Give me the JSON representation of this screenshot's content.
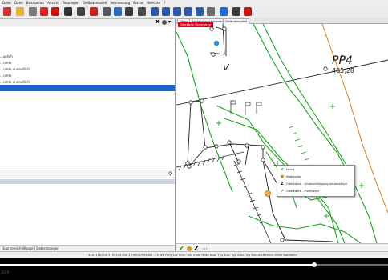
{
  "menubar": [
    "Datei",
    "Datei",
    "Bearbeiten",
    "Ansicht",
    "Bearingen",
    "Geländemodell",
    "Vermessung",
    "Extras",
    "Berichte",
    "?"
  ],
  "left_panel": {
    "items": [
      "...uelich",
      "...rante",
      "...rante undeutlich",
      "...rante",
      "...rante undeutlich",
      ""
    ],
    "selected_index": 5,
    "bottom_label": "Duurbereich-Waage | Datenmanger"
  },
  "map": {
    "tabs": [
      "Demo",
      "Bestand und Kataster",
      "Geländemodell"
    ],
    "red_tip": "Oberkante / Unterkante",
    "labels": {
      "point_name": "PP4",
      "point_value": "405,28",
      "marker": "V"
    },
    "context_menu": [
      {
        "label": "Fertig",
        "icon": "check-icon"
      },
      {
        "label": "Abbrechen",
        "icon": "cancel-icon"
      },
      {
        "label": "Oberkante - Linienverfolgung automatisch",
        "icon": "z-icon"
      },
      {
        "label": "Oberkante - Punktwahl",
        "icon": "pick-icon"
      }
    ]
  },
  "statusbar": "4587118,000   5705100,000   2    F/RE/K/F/ENDE   ...   X   WB   Fang   Lot   Schn. aus   Ende   Mitte   Ausr. Typ   Ausr. Typ   Ausr. Typ   Bereich-Bereich   Hohe Nahbehm",
  "player": {
    "progress": 0.81,
    "time": "0:20"
  },
  "colors": {
    "line_green": "#19a619",
    "orange": "#e07b1a",
    "selection": "#1e63c8",
    "red": "#d9001b"
  }
}
